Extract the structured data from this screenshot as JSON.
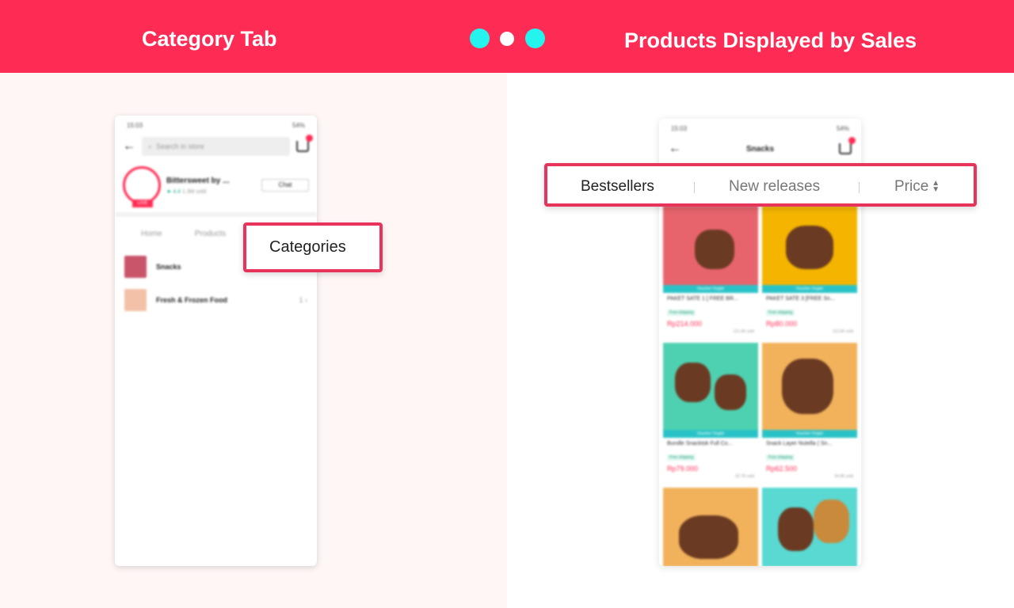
{
  "banner": {
    "left_title": "Category Tab",
    "right_title": "Products Displayed by Sales",
    "colors": {
      "background": "#fe2c55",
      "dot_accent": "#25f4ee"
    }
  },
  "left_phone": {
    "status_time": "15:03",
    "status_icons": "54%",
    "search_placeholder": "Search in store",
    "shop": {
      "name": "Bittersweet by ...",
      "rating": "★ 4.4",
      "sold": "1.3M sold",
      "live_label": "LIVE",
      "chat_label": "Chat"
    },
    "tabs": [
      "Home",
      "Products"
    ],
    "categories": [
      {
        "name": "Snacks",
        "count": ""
      },
      {
        "name": "Fresh & Frozen Food",
        "count": "1"
      }
    ]
  },
  "right_phone": {
    "status_time": "15:03",
    "status_icons": "54%",
    "title": "Snacks",
    "products": [
      {
        "title": "PAKET SATE 1 [ FREE BR...",
        "shipping": "Free shipping",
        "price": "Rp214.000",
        "sold": "121.4K sold",
        "voucher": "Voucher Ongkir"
      },
      {
        "title": "PAKET SATE 3 [FREE Sn...",
        "shipping": "Free shipping",
        "price": "Rp80.000",
        "sold": "112.5K sold",
        "voucher": "Voucher Ongkir"
      },
      {
        "title": "Bundle Snacktok Full Co...",
        "shipping": "Free shipping",
        "price": "Rp79.000",
        "sold": "62.7K sold",
        "voucher": "Voucher Ongkir"
      },
      {
        "title": "Snack Layer Nutella ( Sn...",
        "shipping": "Free shipping",
        "price": "Rp62.500",
        "sold": "54.9K sold",
        "voucher": "Voucher Ongkir"
      }
    ]
  },
  "callouts": {
    "categories_label": "Categories",
    "sort_options": [
      "Bestsellers",
      "New releases",
      "Price"
    ],
    "border_color": "#e8345a"
  }
}
